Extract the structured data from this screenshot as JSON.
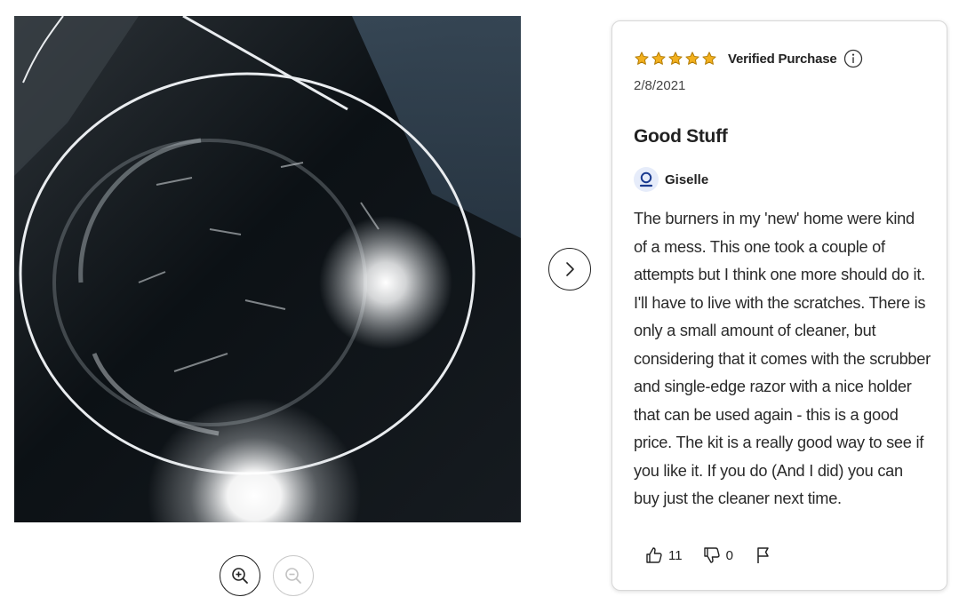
{
  "photo": {
    "icon": "review-photo",
    "description_hidden": ""
  },
  "controls": {
    "zoom_in_icon": "zoom-in-icon",
    "zoom_out_icon": "zoom-out-icon",
    "next_icon": "chevron-right-icon"
  },
  "review": {
    "rating": 5,
    "rating_max": 5,
    "verified_label": "Verified Purchase",
    "date": "2/8/2021",
    "title": "Good Stuff",
    "author": "Giselle",
    "body": "The burners in my 'new' home were kind of a mess. This one took a couple of attempts but I think one more should do it. I'll have to live with the scratches. There is only a small amount of cleaner, but considering that it comes with the scrubber and single-edge razor with a nice holder that can be used again - this is a good price. The kit is a really good way to see if you like it. If you do (And I did) you can buy just the cleaner next time.",
    "helpful_count": "11",
    "unhelpful_count": "0"
  },
  "colors": {
    "star": "#f2b01e",
    "accent": "#1a3a8f",
    "avatar_bg": "#e6ecfa"
  }
}
